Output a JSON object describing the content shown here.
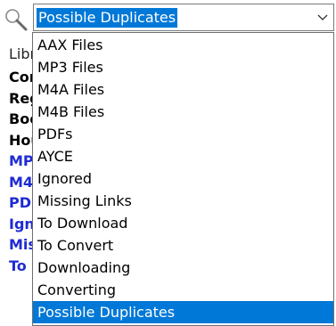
{
  "search": {
    "icon": "search-icon"
  },
  "combo": {
    "value": "Possible Duplicates",
    "arrow_icon": "chevron-down-icon",
    "accent": "#0078d7"
  },
  "background_list": [
    {
      "text": "Libr",
      "style": "plain"
    },
    {
      "text": "Con",
      "style": "bold"
    },
    {
      "text": "Reg",
      "style": "bold"
    },
    {
      "text": "Boo",
      "style": "bold"
    },
    {
      "text": "Hou",
      "style": "bold"
    },
    {
      "text": "MP",
      "style": "blue"
    },
    {
      "text": "M4",
      "style": "blue"
    },
    {
      "text": "PDI",
      "style": "blue"
    },
    {
      "text": "Ign",
      "style": "blue"
    },
    {
      "text": "Mis",
      "style": "blue"
    },
    {
      "text": "To D",
      "style": "blue"
    }
  ],
  "dropdown": {
    "items": [
      "AAX Files",
      "MP3 Files",
      "M4A Files",
      "M4B Files",
      "PDFs",
      "AYCE",
      "Ignored",
      "Missing Links",
      "To Download",
      "To Convert",
      "Downloading",
      "Converting",
      "Possible Duplicates"
    ],
    "selected_index": 12
  }
}
